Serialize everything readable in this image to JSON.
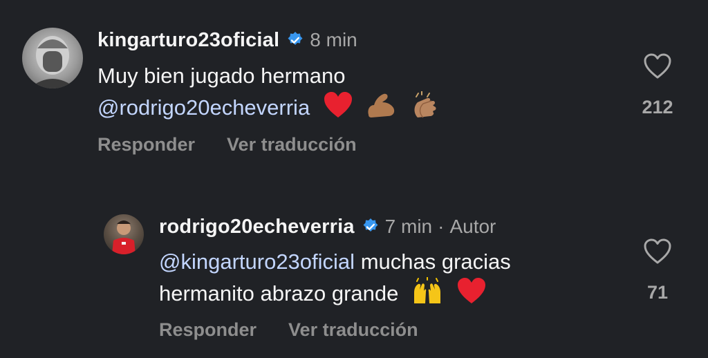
{
  "comments": [
    {
      "username": "kingarturo23oficial",
      "time": "8 min",
      "author_tag": "",
      "text_line1": "Muy bien jugado hermano",
      "mention": "@rodrigo20echeverria",
      "text_rest": "",
      "emojis": [
        "red-heart",
        "flexed-biceps",
        "clapping-hands"
      ],
      "reply_label": "Responder",
      "translate_label": "Ver traducción",
      "likes": "212"
    },
    {
      "username": "rodrigo20echeverria",
      "time": "7 min",
      "separator": "·",
      "author_tag": "Autor",
      "mention": "@kingarturo23oficial",
      "text_line1_rest": "muchas gracias",
      "text_line2": "hermanito abrazo grande",
      "emojis": [
        "raising-hands",
        "red-heart"
      ],
      "reply_label": "Responder",
      "translate_label": "Ver traducción",
      "likes": "71"
    }
  ],
  "colors": {
    "background": "#202226",
    "mention": "#c3d6ff",
    "verified": "#3897f0",
    "muted": "#a8a8a8"
  }
}
